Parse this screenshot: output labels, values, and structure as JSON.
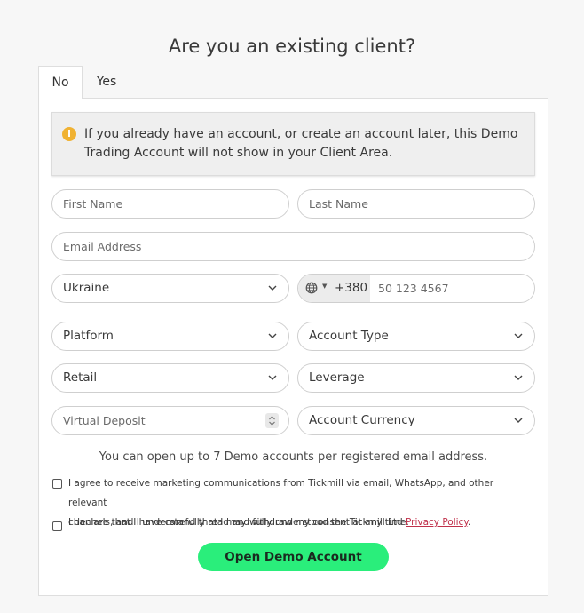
{
  "header": {
    "title": "Are you an existing client?"
  },
  "tabs": [
    {
      "label": "No",
      "active": true
    },
    {
      "label": "Yes",
      "active": false
    }
  ],
  "notice": {
    "icon": "info-icon",
    "text": "If you already have an account, or create an account later, this Demo Trading Account will not show in your Client Area."
  },
  "form": {
    "first_name": {
      "placeholder": "First Name",
      "value": ""
    },
    "last_name": {
      "placeholder": "Last Name",
      "value": ""
    },
    "email": {
      "placeholder": "Email Address",
      "value": ""
    },
    "country": {
      "value": "Ukraine"
    },
    "phone": {
      "dial_code": "+380",
      "placeholder": "50 123 4567",
      "value": ""
    },
    "platform": {
      "value": "Platform"
    },
    "account_type": {
      "value": "Account Type"
    },
    "client_type": {
      "value": "Retail"
    },
    "leverage": {
      "value": "Leverage"
    },
    "virtual_deposit": {
      "placeholder": "Virtual Deposit",
      "value": ""
    },
    "account_currency": {
      "value": "Account Currency"
    }
  },
  "info_line": "You can open up to 7 Demo accounts per registered email address.",
  "consents": {
    "marketing_line1": "I agree to receive marketing communications from Tickmill via email, WhatsApp, and other relevant",
    "marketing_line2": "channels, and I understand that I may withdraw my consent at any time.",
    "privacy_prefix": "I declare that I have carefully read and fully understood the Tickmill Ltd ",
    "privacy_link": "Privacy Policy",
    "privacy_suffix": "."
  },
  "submit_label": "Open Demo Account",
  "colors": {
    "accent": "#2aee7b",
    "notice_icon": "#f0b232",
    "link": "#c0304a"
  }
}
